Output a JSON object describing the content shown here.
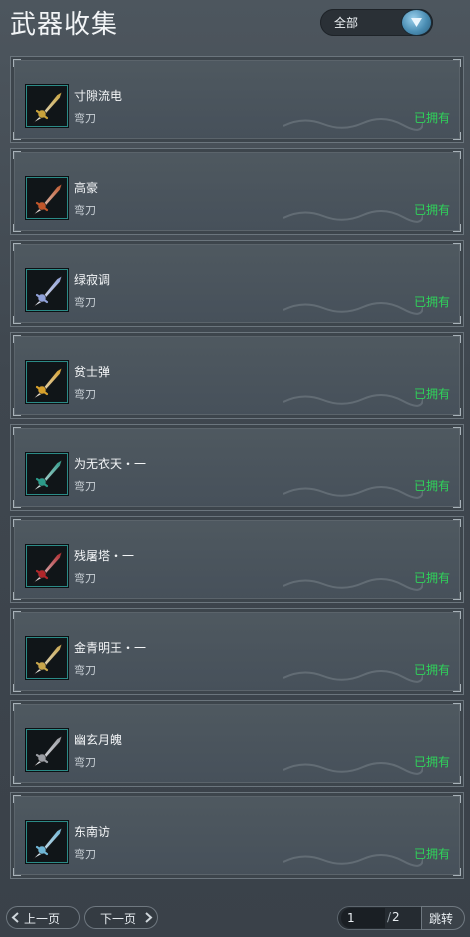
{
  "header": {
    "title": "武器收集",
    "filter": {
      "selected": "全部"
    }
  },
  "weapons": [
    {
      "name": "寸隙流电",
      "type": "弯刀",
      "status": "已拥有",
      "accent": "#c9a33a"
    },
    {
      "name": "高豪",
      "type": "弯刀",
      "status": "已拥有",
      "accent": "#c1562a"
    },
    {
      "name": "绿寂调",
      "type": "弯刀",
      "status": "已拥有",
      "accent": "#8fa0d8"
    },
    {
      "name": "贫士弹",
      "type": "弯刀",
      "status": "已拥有",
      "accent": "#d7a12c"
    },
    {
      "name": "为无衣天・一",
      "type": "弯刀",
      "status": "已拥有",
      "accent": "#2c9b8a"
    },
    {
      "name": "残屠塔・一",
      "type": "弯刀",
      "status": "已拥有",
      "accent": "#b0262a"
    },
    {
      "name": "金青明王・一",
      "type": "弯刀",
      "status": "已拥有",
      "accent": "#c8a64b"
    },
    {
      "name": "幽玄月魄",
      "type": "弯刀",
      "status": "已拥有",
      "accent": "#9a9da3"
    },
    {
      "name": "东南访",
      "type": "弯刀",
      "status": "已拥有",
      "accent": "#6fb6d6"
    }
  ],
  "footer": {
    "prev_label": "上一页",
    "next_label": "下一页",
    "page_current": "1",
    "page_total": "2",
    "jump_label": "跳转"
  },
  "colors": {
    "owned": "#2fd35a",
    "accent": "#4a8db3"
  }
}
